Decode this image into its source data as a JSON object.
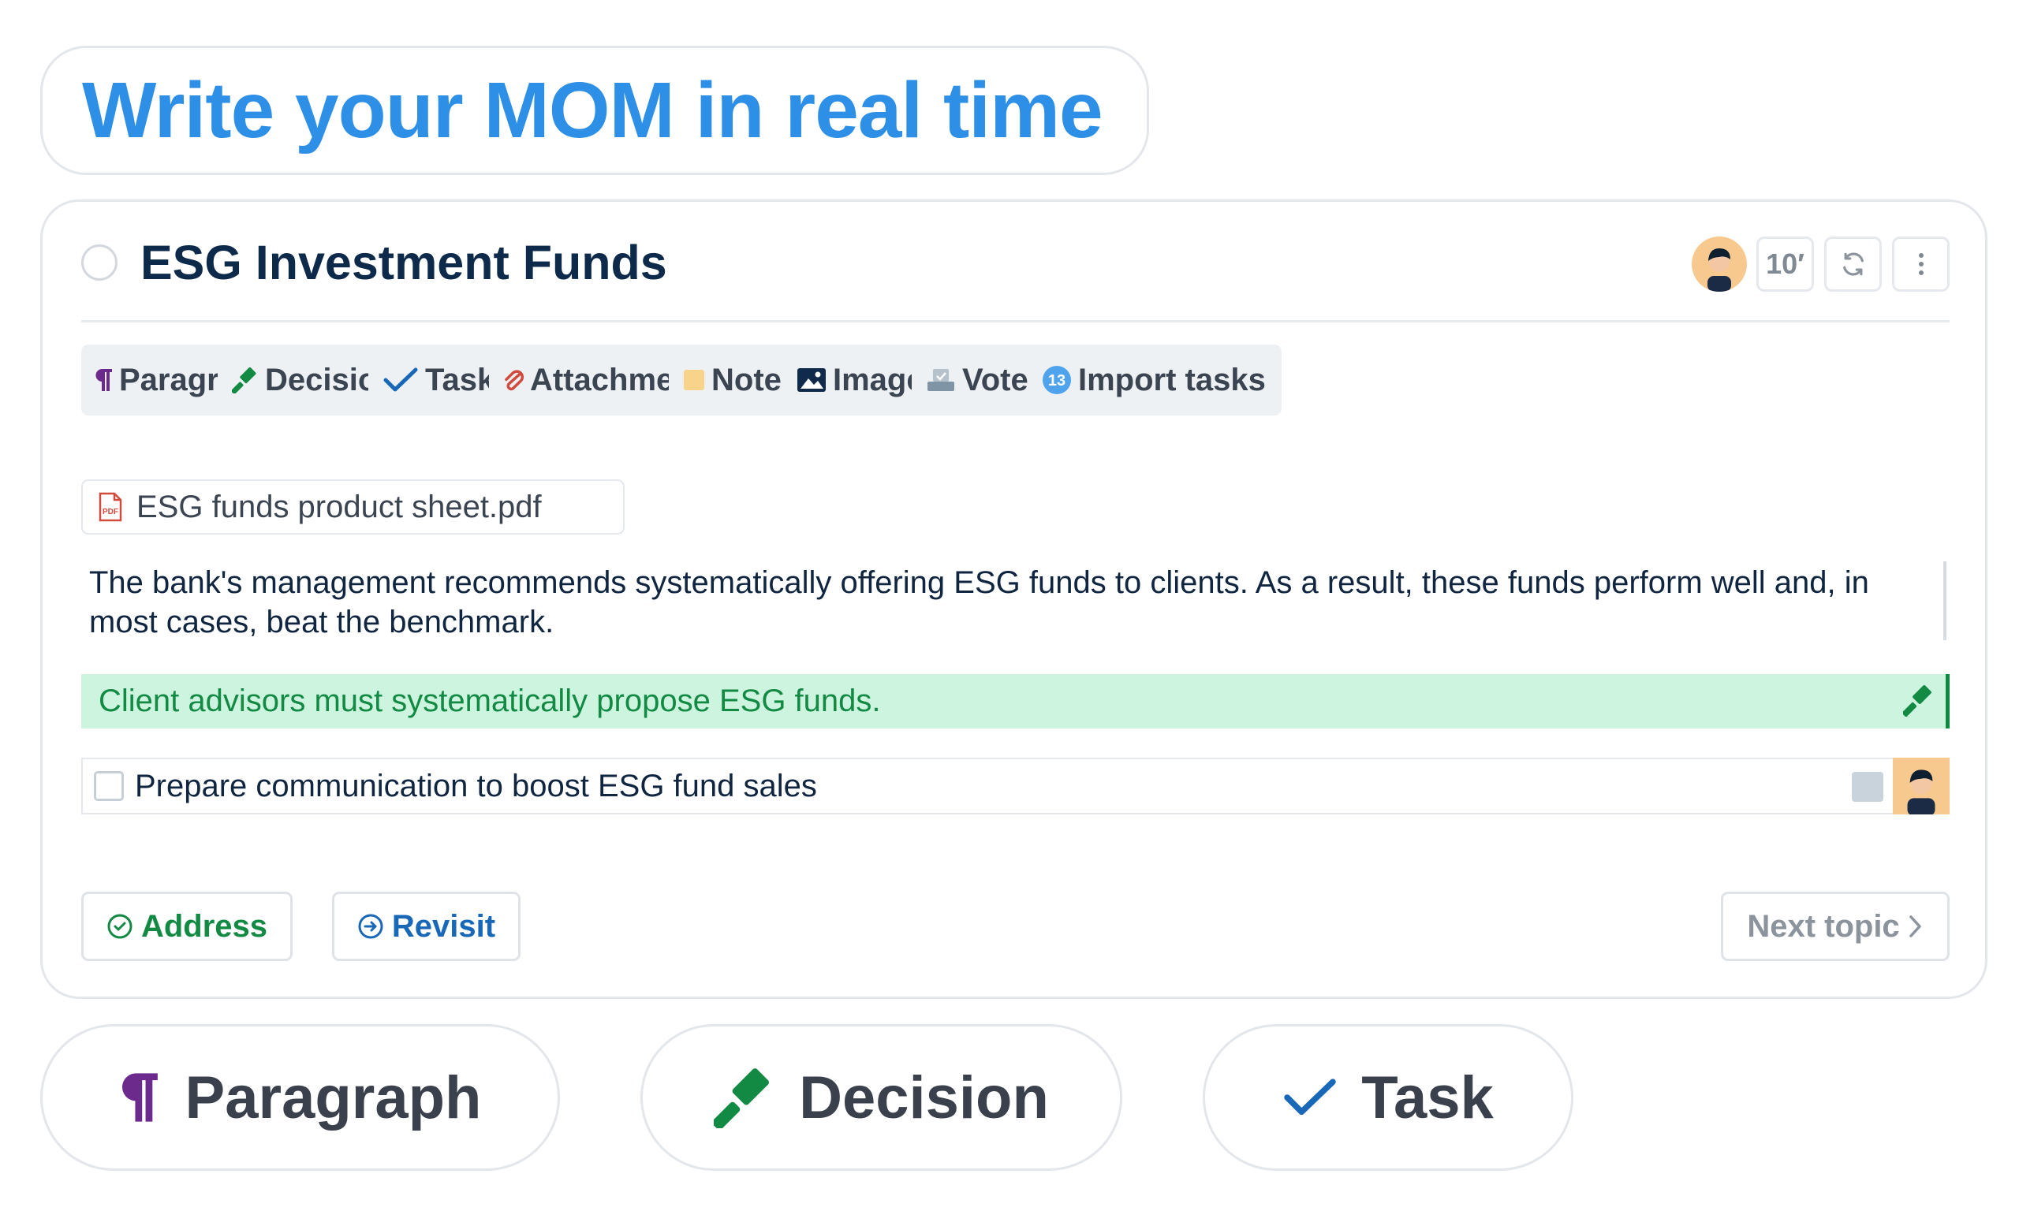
{
  "headline": "Write your MOM in real time",
  "topic": {
    "title": "ESG Investment Funds",
    "duration": "10′"
  },
  "toolbar": [
    {
      "label": "Paragraph",
      "icon": "pilcrow-icon"
    },
    {
      "label": "Decision",
      "icon": "gavel-icon"
    },
    {
      "label": "Task",
      "icon": "checkmark-icon"
    },
    {
      "label": "Attachment",
      "icon": "paperclip-icon"
    },
    {
      "label": "Note",
      "icon": "sticky-note-icon"
    },
    {
      "label": "Image",
      "icon": "image-icon"
    },
    {
      "label": "Vote",
      "icon": "ballot-box-icon"
    },
    {
      "label": "Import tasks",
      "icon": "import-badge-icon",
      "badge": "13"
    }
  ],
  "attachment": {
    "filename": "ESG funds product sheet.pdf",
    "icon_text": "PDF"
  },
  "paragraph": "The bank's management recommends systematically offering ESG funds to clients. As a result, these funds perform well and, in most cases, beat the benchmark.",
  "decision": "Client advisors must systematically propose ESG funds.",
  "task": {
    "text": "Prepare communication to boost ESG fund sales",
    "checked": false
  },
  "footer": {
    "address_label": "Address",
    "revisit_label": "Revisit",
    "next_label": "Next topic"
  },
  "big_pills": [
    {
      "label": "Paragraph"
    },
    {
      "label": "Decision"
    },
    {
      "label": "Task"
    }
  ],
  "colors": {
    "headline": "#2e8fe6",
    "paragraph_icon": "#6b2a8c",
    "decision": "#138a44",
    "decision_bg": "#cdf4df",
    "task_icon": "#1968b8",
    "attachment_icon": "#d14b3c",
    "note_icon": "#f9d38a"
  }
}
